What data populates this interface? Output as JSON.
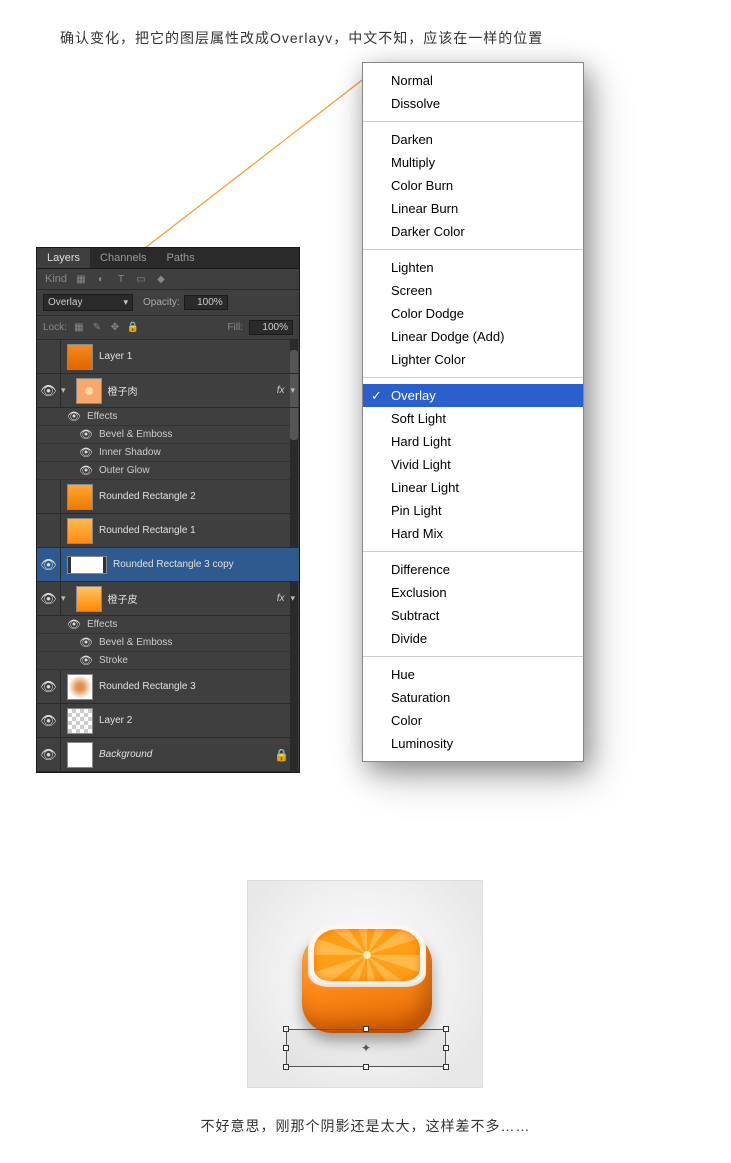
{
  "caption_top": "确认变化，把它的图层属性改成Overlayv，中文不知，应该在一样的位置",
  "caption_bottom": "不好意思，刚那个阴影还是太大，这样差不多……",
  "panel": {
    "tabs": {
      "layers": "Layers",
      "channels": "Channels",
      "paths": "Paths"
    },
    "kind_label": "Kind",
    "blend_value": "Overlay",
    "opacity_label": "Opacity:",
    "opacity_value": "100%",
    "lock_label": "Lock:",
    "fill_label": "Fill:",
    "fill_value": "100%",
    "layers": [
      {
        "name": "Layer 1",
        "vis": false,
        "style": "orange1"
      },
      {
        "name": "橙子肉",
        "vis": true,
        "fx": true,
        "tri": true,
        "style": "pulp"
      },
      {
        "eff_label": "Effects"
      },
      {
        "sub": "Bevel & Emboss"
      },
      {
        "sub": "Inner Shadow"
      },
      {
        "sub": "Outer Glow"
      },
      {
        "name": "Rounded Rectangle 2",
        "vis": false,
        "style": "orange2"
      },
      {
        "name": "Rounded Rectangle 1",
        "vis": false,
        "style": "orange3"
      },
      {
        "name": "Rounded Rectangle 3 copy",
        "vis": true,
        "selected": true,
        "wide": true
      },
      {
        "name": "橙子皮",
        "vis": true,
        "fx": true,
        "tri": true,
        "style": "orange4"
      },
      {
        "eff_label": "Effects"
      },
      {
        "sub": "Bevel & Emboss"
      },
      {
        "sub": "Stroke"
      },
      {
        "name": "Rounded Rectangle 3",
        "vis": true,
        "style": "bottom"
      },
      {
        "name": "Layer 2",
        "vis": true,
        "style": "transp"
      },
      {
        "name": "Background",
        "vis": true,
        "lock": true,
        "italic": true,
        "style": "white"
      }
    ]
  },
  "blend_modes": {
    "groups": [
      [
        "Normal",
        "Dissolve"
      ],
      [
        "Darken",
        "Multiply",
        "Color Burn",
        "Linear Burn",
        "Darker Color"
      ],
      [
        "Lighten",
        "Screen",
        "Color Dodge",
        "Linear Dodge (Add)",
        "Lighter Color"
      ],
      [
        "Overlay",
        "Soft Light",
        "Hard Light",
        "Vivid Light",
        "Linear Light",
        "Pin Light",
        "Hard Mix"
      ],
      [
        "Difference",
        "Exclusion",
        "Subtract",
        "Divide"
      ],
      [
        "Hue",
        "Saturation",
        "Color",
        "Luminosity"
      ]
    ],
    "selected": "Overlay"
  }
}
